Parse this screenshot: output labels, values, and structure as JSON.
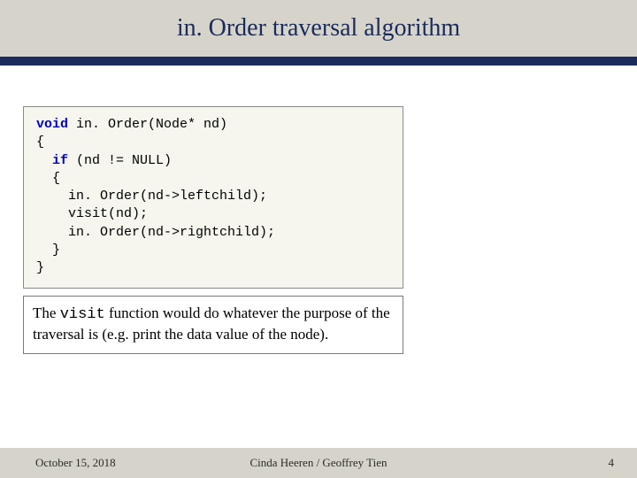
{
  "title": "in. Order traversal algorithm",
  "code": {
    "kw_void": "void",
    "sig_rest": " in. Order(Node* nd)",
    "l2": "{",
    "l3a": "  ",
    "kw_if": "if",
    "l3b": " (nd != NULL)",
    "l4": "  {",
    "l5": "    in. Order(nd->leftchild);",
    "l6": "    visit(nd);",
    "l7": "    in. Order(nd->rightchild);",
    "l8": "  }",
    "l9": "}"
  },
  "note": {
    "pre": "The ",
    "visit": "visit",
    "post": " function would do whatever the purpose of the traversal is (e.g. print the data value of the node)."
  },
  "footer": {
    "date": "October 15, 2018",
    "authors": "Cinda Heeren / Geoffrey Tien",
    "page": "4"
  }
}
